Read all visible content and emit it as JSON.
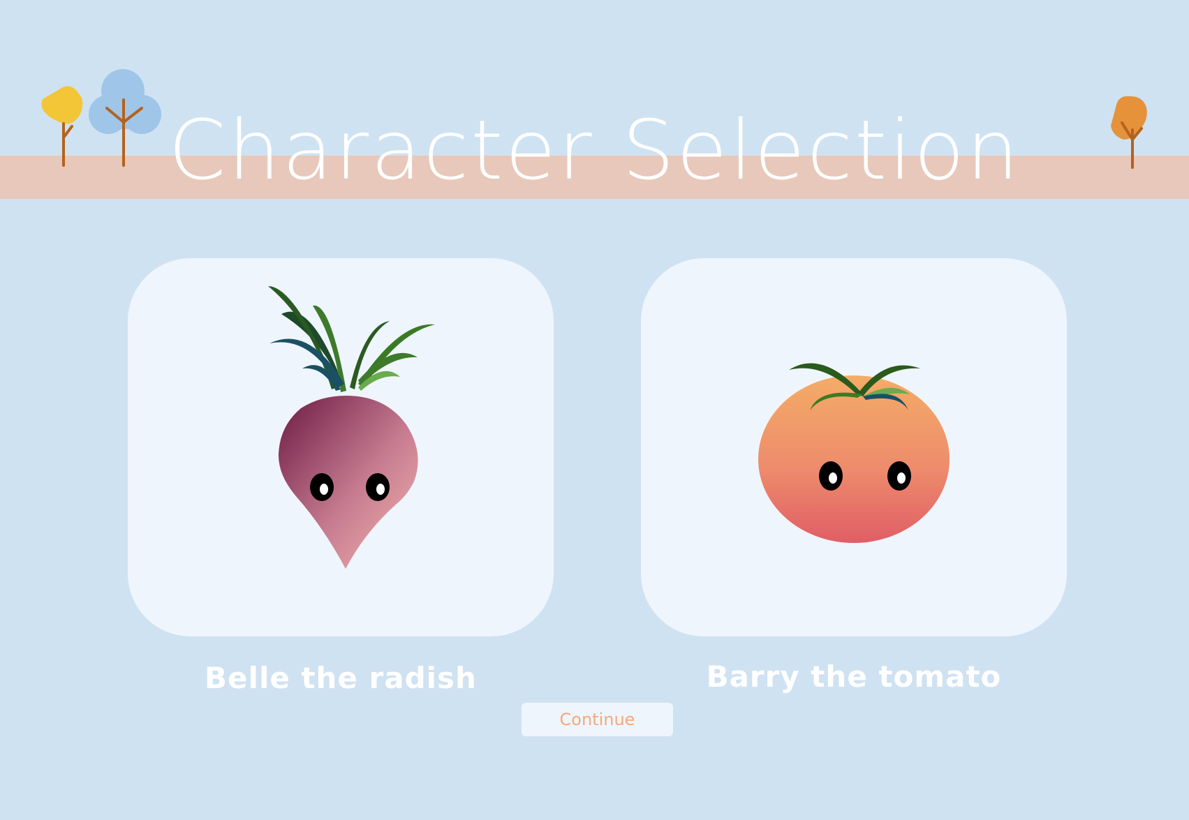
{
  "header": {
    "title": "Character Selection"
  },
  "characters": [
    {
      "name": "Belle the radish",
      "icon": "radish-character"
    },
    {
      "name": "Barry the tomato",
      "icon": "tomato-character"
    }
  ],
  "actions": {
    "continue_label": "Continue"
  },
  "colors": {
    "sky": "#cfe2f2",
    "band": "#e7c8ba",
    "card": "#eff5fc",
    "continue_text": "#f4a97d"
  }
}
